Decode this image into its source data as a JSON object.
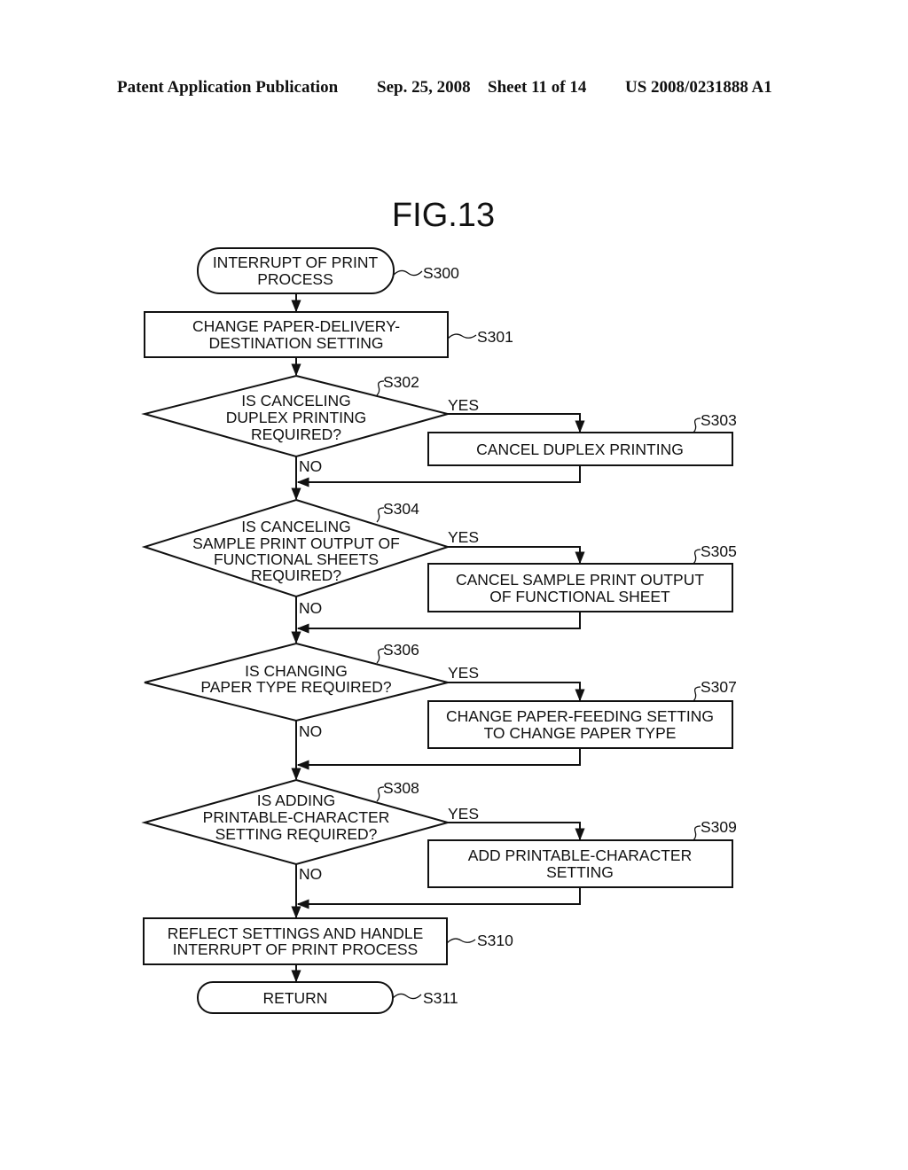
{
  "header": {
    "publication": "Patent Application Publication",
    "date": "Sep. 25, 2008",
    "sheet": "Sheet 11 of 14",
    "patent_number": "US 2008/0231888 A1"
  },
  "figure": {
    "title": "FIG.13",
    "steps": {
      "s300": {
        "id": "S300",
        "type": "terminal",
        "lines": [
          "INTERRUPT OF PRINT",
          "PROCESS"
        ]
      },
      "s301": {
        "id": "S301",
        "type": "process",
        "lines": [
          "CHANGE PAPER-DELIVERY-",
          "DESTINATION SETTING"
        ]
      },
      "s302": {
        "id": "S302",
        "type": "decision",
        "lines": [
          "IS CANCELING",
          "DUPLEX PRINTING",
          "REQUIRED?"
        ]
      },
      "s303": {
        "id": "S303",
        "type": "process",
        "lines": [
          "CANCEL DUPLEX PRINTING"
        ]
      },
      "s304": {
        "id": "S304",
        "type": "decision",
        "lines": [
          "IS CANCELING",
          "SAMPLE PRINT OUTPUT OF",
          "FUNCTIONAL SHEETS",
          "REQUIRED?"
        ]
      },
      "s305": {
        "id": "S305",
        "type": "process",
        "lines": [
          "CANCEL SAMPLE PRINT OUTPUT",
          "OF FUNCTIONAL SHEET"
        ]
      },
      "s306": {
        "id": "S306",
        "type": "decision",
        "lines": [
          "IS CHANGING",
          "PAPER TYPE REQUIRED?"
        ]
      },
      "s307": {
        "id": "S307",
        "type": "process",
        "lines": [
          "CHANGE PAPER-FEEDING SETTING",
          "TO CHANGE PAPER TYPE"
        ]
      },
      "s308": {
        "id": "S308",
        "type": "decision",
        "lines": [
          "IS ADDING",
          "PRINTABLE-CHARACTER",
          "SETTING REQUIRED?"
        ]
      },
      "s309": {
        "id": "S309",
        "type": "process",
        "lines": [
          "ADD PRINTABLE-CHARACTER",
          "SETTING"
        ]
      },
      "s310": {
        "id": "S310",
        "type": "process",
        "lines": [
          "REFLECT SETTINGS AND HANDLE",
          "INTERRUPT OF PRINT PROCESS"
        ]
      },
      "s311": {
        "id": "S311",
        "type": "terminal",
        "lines": [
          "RETURN"
        ]
      }
    },
    "branch_labels": {
      "yes": "YES",
      "no": "NO"
    },
    "edges": [
      {
        "from": "S300",
        "to": "S301"
      },
      {
        "from": "S301",
        "to": "S302"
      },
      {
        "from": "S302",
        "to": "S303",
        "label": "YES"
      },
      {
        "from": "S302",
        "to": "S304",
        "label": "NO"
      },
      {
        "from": "S303",
        "to": "S304"
      },
      {
        "from": "S304",
        "to": "S305",
        "label": "YES"
      },
      {
        "from": "S304",
        "to": "S306",
        "label": "NO"
      },
      {
        "from": "S305",
        "to": "S306"
      },
      {
        "from": "S306",
        "to": "S307",
        "label": "YES"
      },
      {
        "from": "S306",
        "to": "S308",
        "label": "NO"
      },
      {
        "from": "S307",
        "to": "S308"
      },
      {
        "from": "S308",
        "to": "S309",
        "label": "YES"
      },
      {
        "from": "S308",
        "to": "S310",
        "label": "NO"
      },
      {
        "from": "S309",
        "to": "S310"
      },
      {
        "from": "S310",
        "to": "S311"
      }
    ]
  }
}
